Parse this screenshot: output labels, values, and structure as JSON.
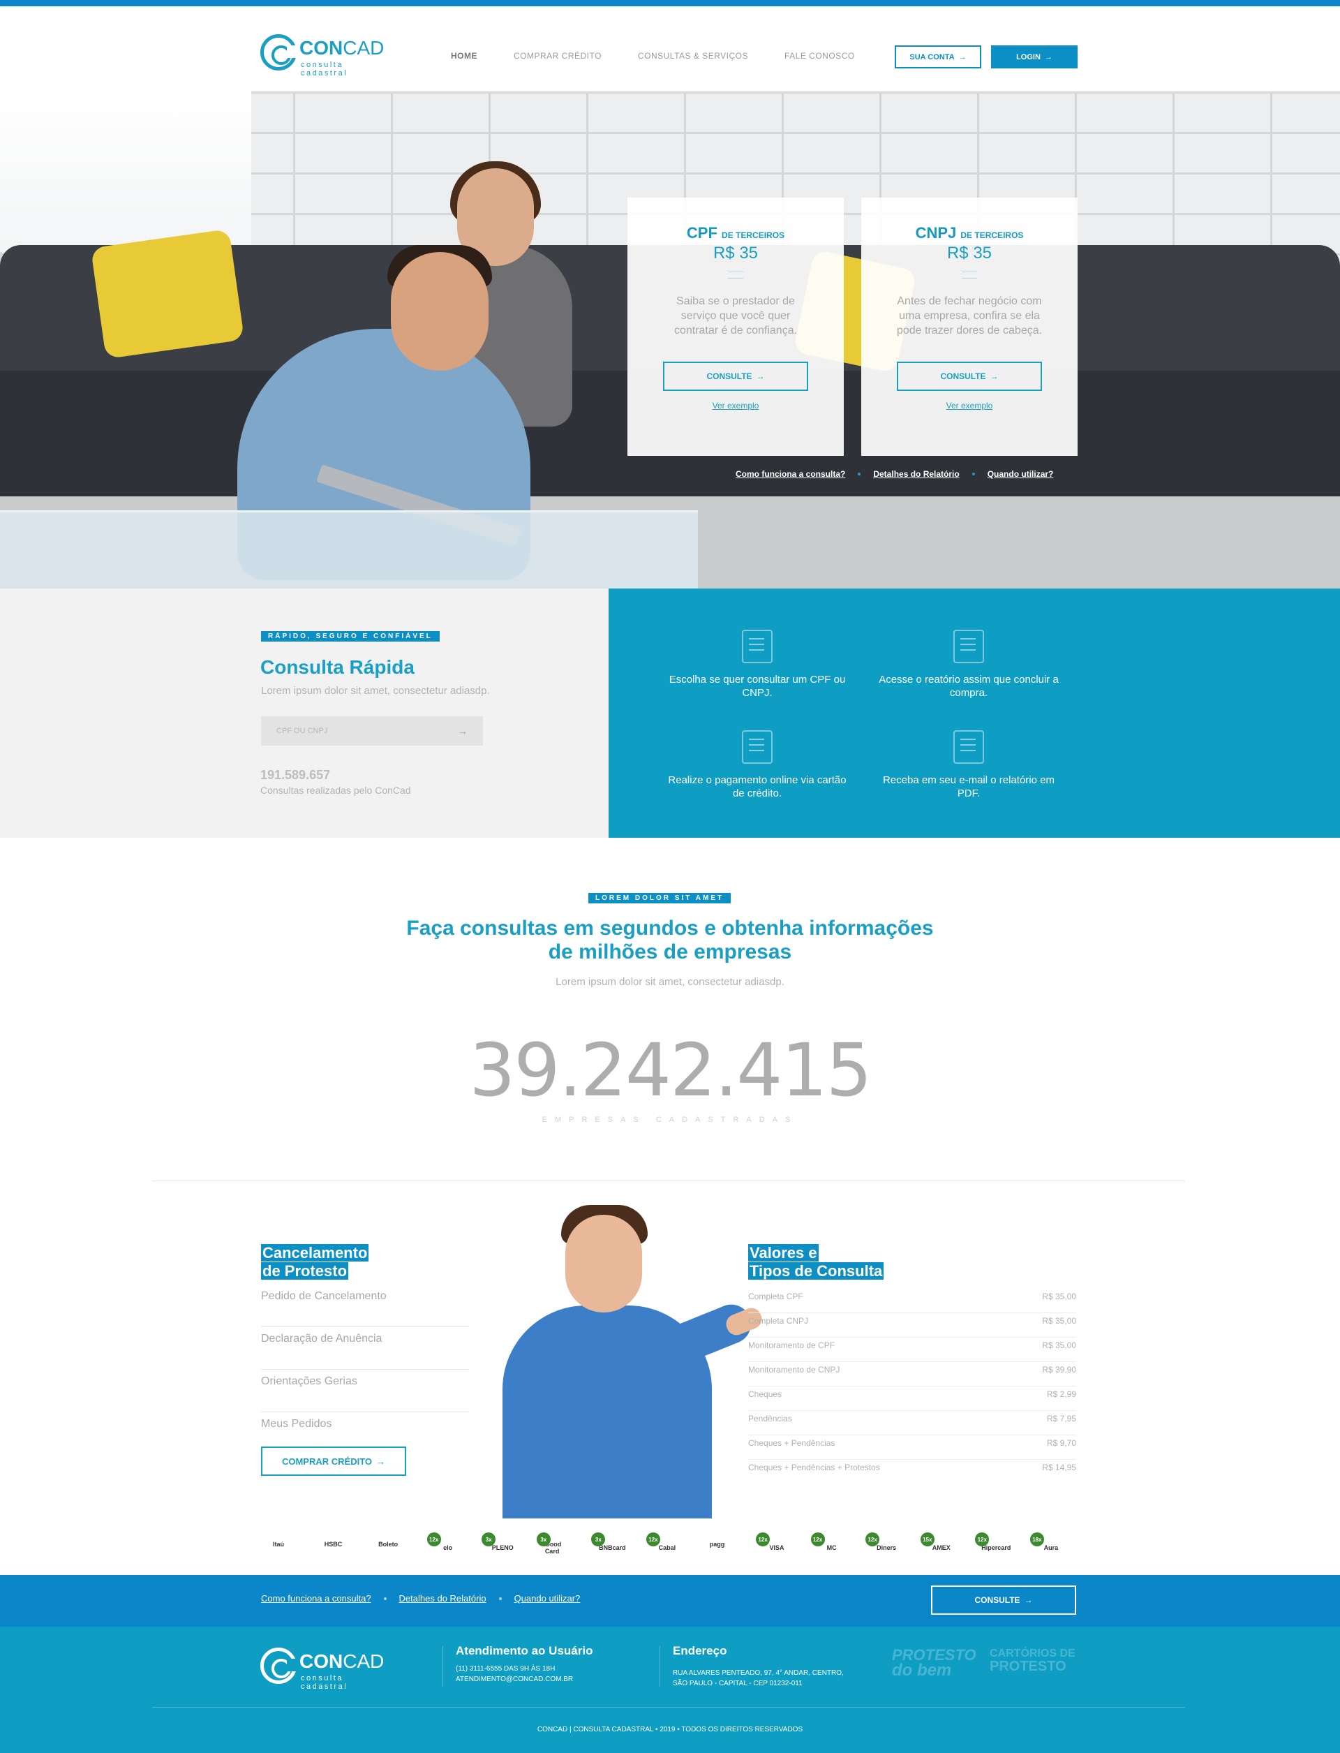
{
  "header": {
    "logo": {
      "text_bold": "CON",
      "text_light": "CAD",
      "tagline": "consulta cadastral"
    },
    "nav": [
      "HOME",
      "COMPRAR CRÉDITO",
      "CONSULTAS & SERVIÇOS",
      "FALE CONOSCO"
    ],
    "account_button": "SUA CONTA",
    "login_button": "LOGIN",
    "arrow": "→"
  },
  "hero": {
    "cards": [
      {
        "title": "CPF",
        "title_suffix": "DE TERCEIROS",
        "price": "R$ 35",
        "description": "Saiba se o prestador de serviço que você quer contratar é de confiança.",
        "button": "CONSULTE",
        "link": "Ver exemplo"
      },
      {
        "title": "CNPJ",
        "title_suffix": "DE TERCEIROS",
        "price": "R$ 35",
        "description": "Antes de fechar negócio com uma empresa, confira se ela pode trazer dores de cabeça.",
        "button": "CONSULTE",
        "link": "Ver exemplo"
      }
    ],
    "links": [
      "Como funciona a consulta?",
      "Detalhes do Relatório",
      "Quando utilizar?"
    ]
  },
  "quick": {
    "tag": "RÁPIDO, SEGURO E CONFIÁVEL",
    "title": "Consulta Rápida",
    "subtitle": "Lorem ipsum dolor sit amet, consectetur adiasdp.",
    "input_placeholder": "CPF OU CNPJ",
    "count": "191.589.657",
    "count_label": "Consultas realizadas pelo ConCad",
    "steps": [
      {
        "icon": "document-search-icon",
        "text": "Escolha se quer consultar um CPF ou CNPJ."
      },
      {
        "icon": "report-icon",
        "text": "Acesse o reatório assim que concluir a compra."
      },
      {
        "icon": "credit-card-payment-icon",
        "text": "Realize o pagamento online via cartão de crédito."
      },
      {
        "icon": "email-pdf-icon",
        "text": "Receba em seu e-mail o relatório em PDF."
      }
    ]
  },
  "stats": {
    "tag": "LOREM DOLOR SIT AMET",
    "title_line1": "Faça consultas em segundos e obtenha informações",
    "title_line2": "de milhões de empresas",
    "subtitle": "Lorem ipsum dolor sit amet, consectetur adiasdp.",
    "number": "39.242.415",
    "label": "EMPRESAS CADASTRADAS"
  },
  "cancelamento": {
    "title_line1": "Cancelamento",
    "title_line2": "de Protesto",
    "items": [
      "Pedido de Cancelamento",
      "Declaração de Anuência",
      "Orientações Gerias",
      "Meus Pedidos"
    ],
    "button": "COMPRAR CRÉDITO"
  },
  "valores": {
    "title_line1": "Valores e",
    "title_line2": "Tipos de Consulta",
    "rows": [
      {
        "name": "Completa CPF",
        "price": "R$ 35,00"
      },
      {
        "name": "Completa CNPJ",
        "price": "R$ 35,00"
      },
      {
        "name": "Monitoramento de CPF",
        "price": "R$ 35,00"
      },
      {
        "name": "Monitoramento de CNPJ",
        "price": "R$ 39,90"
      },
      {
        "name": "Cheques",
        "price": "R$ 2,99"
      },
      {
        "name": "Pendências",
        "price": "R$ 7,95"
      },
      {
        "name": "Cheques + Pendências",
        "price": "R$ 9,70"
      },
      {
        "name": "Cheques + Pendências + Protestos",
        "price": "R$ 14,95"
      }
    ]
  },
  "payments": [
    {
      "badge": "",
      "mark": "Itaú",
      "icon": "itau-logo-icon"
    },
    {
      "badge": "",
      "mark": "HSBC",
      "icon": "hsbc-logo-icon"
    },
    {
      "badge": "",
      "mark": "Boleto",
      "icon": "boleto-logo-icon"
    },
    {
      "badge": "12x",
      "mark": "elo",
      "icon": "elo-logo-icon"
    },
    {
      "badge": "3x",
      "mark": "PLENO",
      "icon": "pleno-logo-icon"
    },
    {
      "badge": "3x",
      "mark": "Good Card",
      "icon": "goodcard-logo-icon"
    },
    {
      "badge": "3x",
      "mark": "BNBcard",
      "icon": "bnb-logo-icon"
    },
    {
      "badge": "12x",
      "mark": "Cabal",
      "icon": "cabal-logo-icon"
    },
    {
      "badge": "",
      "mark": "pagg",
      "icon": "pagg-logo-icon"
    },
    {
      "badge": "12x",
      "mark": "VISA",
      "icon": "visa-logo-icon"
    },
    {
      "badge": "12x",
      "mark": "MC",
      "icon": "mastercard-logo-icon"
    },
    {
      "badge": "12x",
      "mark": "Diners",
      "icon": "diners-logo-icon"
    },
    {
      "badge": "15x",
      "mark": "AMEX",
      "icon": "amex-logo-icon"
    },
    {
      "badge": "12x",
      "mark": "Hipercard",
      "icon": "hipercard-logo-icon"
    },
    {
      "badge": "18x",
      "mark": "Aura",
      "icon": "aura-logo-icon"
    }
  ],
  "footer_bar": {
    "links": [
      "Como funciona a consulta?",
      "Detalhes do Relatório",
      "Quando utilizar?"
    ],
    "button": "CONSULTE"
  },
  "footer": {
    "support_title": "Atendimento ao Usuário",
    "support_line1": "(11) 3111-6555 DAS 9H ÀS 18H",
    "support_line2": "ATENDIMENTO@CONCAD.COM.BR",
    "address_title": "Endereço",
    "address_line1": "RUA ALVARES PENTEADO, 97, 4° ANDAR, CENTRO,",
    "address_line2": "SÃO PAULO - CAPITAL - CEP 01232-011",
    "seal1_line1": "PROTESTO",
    "seal1_line2": "do bem",
    "seal2_line1": "CARTÓRIOS DE",
    "seal2_line2": "PROTESTO",
    "copyright": "CONCAD | CONSULTA CADASTRAL  •  2019  •  TODOS OS DIREITOS RESERVADOS"
  },
  "colors": {
    "primary": "#0b8fc4",
    "accent": "#1a9fc4",
    "teal": "#0e9dc3"
  }
}
